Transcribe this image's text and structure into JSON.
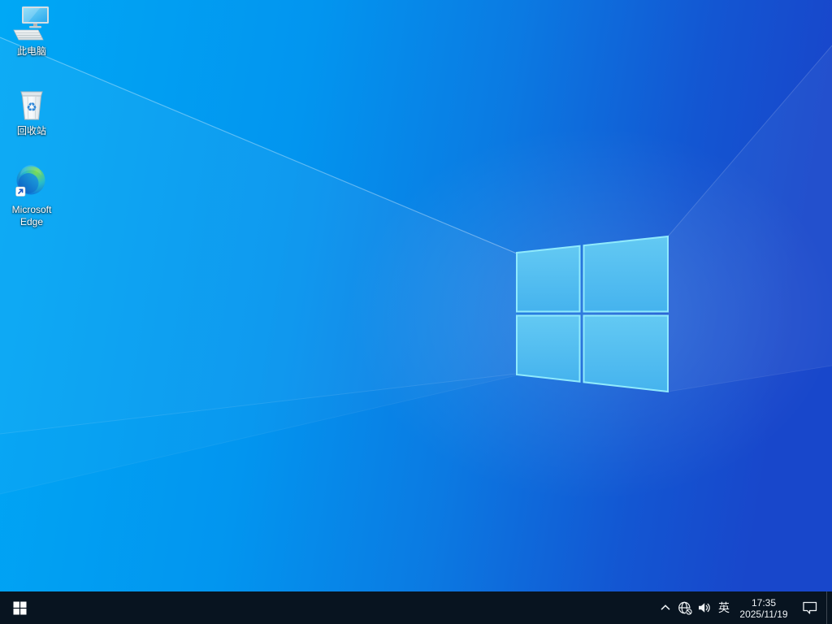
{
  "desktop": {
    "icons": [
      {
        "id": "this-pc",
        "label": "此电脑"
      },
      {
        "id": "recycle-bin",
        "label": "回收站"
      },
      {
        "id": "microsoft-edge",
        "label": "Microsoft Edge"
      }
    ]
  },
  "taskbar": {
    "tray": {
      "language": "英",
      "time": "17:35",
      "date": "2025/11/19"
    }
  },
  "colors": {
    "taskbar_bg": "#081420",
    "desktop_gradient_left": "#00a6f4",
    "desktop_gradient_right": "#1847cb",
    "logo_pane_fill": "#55bef0",
    "logo_pane_border": "#90eafc",
    "tray_fg": "#eef2f5"
  }
}
